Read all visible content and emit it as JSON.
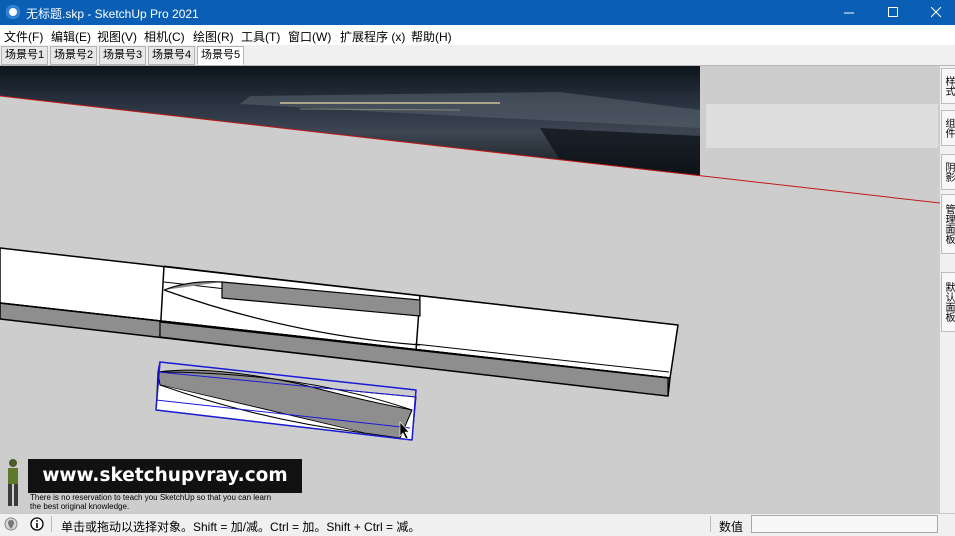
{
  "window": {
    "title": "无标题.skp - SketchUp Pro 2021",
    "app_icon": "sketchup-logo-icon"
  },
  "menu": [
    {
      "label": "文件(F)"
    },
    {
      "label": "编辑(E)"
    },
    {
      "label": "视图(V)"
    },
    {
      "label": "相机(C)"
    },
    {
      "label": "绘图(R)"
    },
    {
      "label": "工具(T)"
    },
    {
      "label": "窗口(W)"
    },
    {
      "label": "扩展程序 (x)"
    },
    {
      "label": "帮助(H)"
    }
  ],
  "scene_tabs": [
    {
      "label": "场景号1"
    },
    {
      "label": "场景号2"
    },
    {
      "label": "场景号3"
    },
    {
      "label": "场景号4"
    },
    {
      "label": "场景号5",
      "active": true
    }
  ],
  "right_tray": [
    {
      "label": "样式"
    },
    {
      "label": "组件"
    },
    {
      "label": "阴影"
    },
    {
      "label": "管理面板"
    },
    {
      "label": "默认面板"
    }
  ],
  "watermark": {
    "url": "www.sketchupvray.com",
    "line1": "There is no reservation to teach you SketchUp so that you can learn",
    "line2": " the best original knowledge."
  },
  "status": {
    "message": "单击或拖动以选择对象。Shift = 加/减。Ctrl = 加。Shift + Ctrl = 减。",
    "value_label": "数值",
    "value": ""
  },
  "colors": {
    "titlebar": "#0a5fb4",
    "viewport_bg": "#cdcdcd",
    "selection": "#1a1ad6",
    "axis_red": "#c41818",
    "face_white": "#ffffff",
    "face_gray": "#8e8e8e"
  },
  "icons": {
    "minimize": "minimize-icon",
    "maximize": "maximize-icon",
    "close": "close-icon",
    "geo": "geo-location-icon",
    "info": "info-icon",
    "cursor": "arrow-cursor-icon"
  }
}
